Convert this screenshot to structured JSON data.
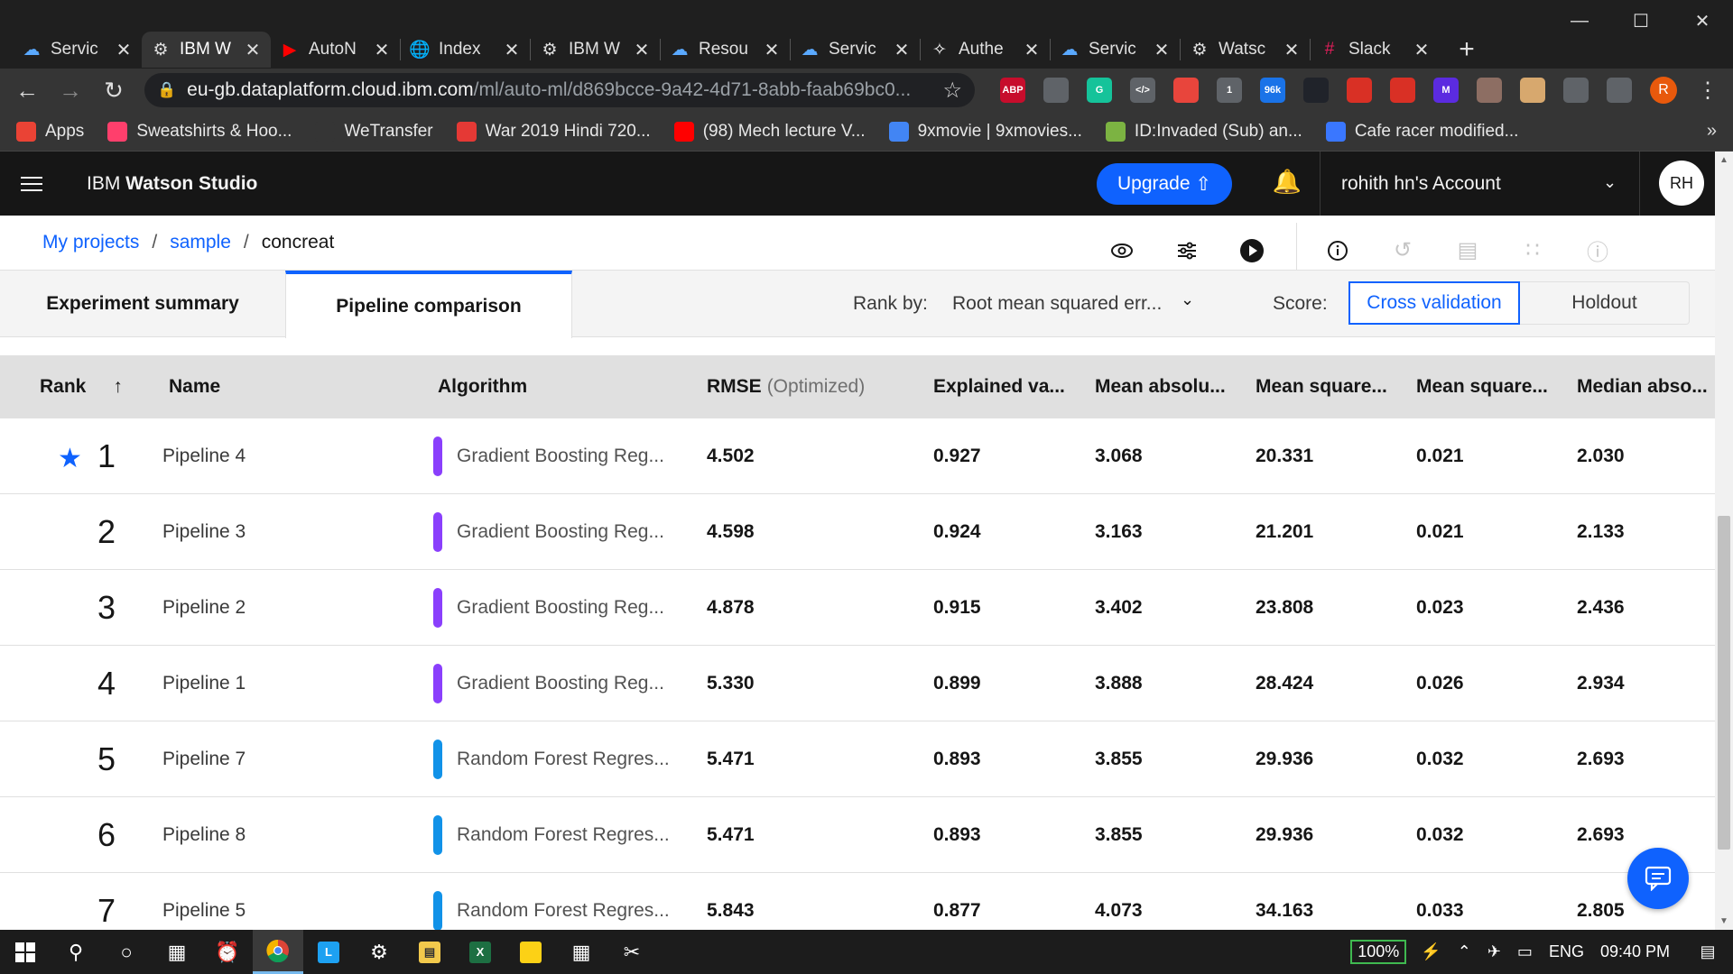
{
  "browser": {
    "tabs": [
      {
        "label": "Servic",
        "icon": "ibm-cloud-icon",
        "active": false
      },
      {
        "label": "IBM W",
        "icon": "watson-icon",
        "active": true
      },
      {
        "label": "AutoN",
        "icon": "youtube-icon",
        "active": false
      },
      {
        "label": "Index",
        "icon": "globe-icon",
        "active": false
      },
      {
        "label": "IBM W",
        "icon": "watson-icon",
        "active": false
      },
      {
        "label": "Resou",
        "icon": "ibm-cloud-icon",
        "active": false
      },
      {
        "label": "Servic",
        "icon": "ibm-cloud-icon",
        "active": false
      },
      {
        "label": "Authe",
        "icon": "auth-icon",
        "active": false
      },
      {
        "label": "Servic",
        "icon": "ibm-cloud-icon",
        "active": false
      },
      {
        "label": "Watsc",
        "icon": "watson-icon",
        "active": false
      },
      {
        "label": "Slack",
        "icon": "slack-icon",
        "active": false
      }
    ],
    "url_host": "eu-gb.dataplatform.cloud.ibm.com",
    "url_path": "/ml/auto-ml/d869bcce-9a42-4d71-8abb-faab69bc0...",
    "extensions": [
      {
        "name": "abp",
        "label": "ABP",
        "color": "#c70d2c"
      },
      {
        "name": "shield",
        "label": "",
        "color": "#5f6368"
      },
      {
        "name": "grammarly",
        "label": "G",
        "color": "#15c39a"
      },
      {
        "name": "code",
        "label": "</>",
        "color": "#5f6368"
      },
      {
        "name": "spiral",
        "label": "",
        "color": "#e8453c"
      },
      {
        "name": "link",
        "label": "1",
        "color": "#5f6368"
      },
      {
        "name": "bird",
        "label": "96k",
        "color": "#1a73e8"
      },
      {
        "name": "react",
        "label": "",
        "color": "#20232a"
      },
      {
        "name": "arrow",
        "label": "",
        "color": "#d93025"
      },
      {
        "name": "record",
        "label": "",
        "color": "#d93025"
      },
      {
        "name": "m",
        "label": "M",
        "color": "#5b2be0"
      },
      {
        "name": "cookie1",
        "label": "",
        "color": "#8d6e63"
      },
      {
        "name": "cookie2",
        "label": "",
        "color": "#d7a86e"
      },
      {
        "name": "puzzle",
        "label": "",
        "color": "#5f6368"
      },
      {
        "name": "playlist",
        "label": "",
        "color": "#5f6368"
      }
    ],
    "profile_initial": "R",
    "bookmarks": [
      {
        "label": "Apps",
        "icon": "apps-grid-icon",
        "color": "#ea4335"
      },
      {
        "label": "Sweatshirts & Hoo...",
        "icon": "myntra-icon",
        "color": "#ff3f6c"
      },
      {
        "label": "WeTransfer",
        "icon": "wetransfer-icon",
        "color": "#353535"
      },
      {
        "label": "War 2019 Hindi 720...",
        "icon": "play-icon",
        "color": "#e53935"
      },
      {
        "label": "(98) Mech lecture V...",
        "icon": "youtube-icon",
        "color": "#ff0000"
      },
      {
        "label": "9xmovie | 9xmovies...",
        "icon": "film-icon",
        "color": "#4285f4"
      },
      {
        "label": "ID:Invaded (Sub) an...",
        "icon": "colorful-icon",
        "color": "#7cb342"
      },
      {
        "label": "Cafe racer modified...",
        "icon": "olx-icon",
        "color": "#3a77ff"
      }
    ]
  },
  "header": {
    "product_prefix": "IBM ",
    "product_name": "Watson Studio",
    "upgrade_label": "Upgrade",
    "account_label": "rohith hn's Account",
    "avatar_initials": "RH"
  },
  "breadcrumb": {
    "items": [
      "My projects",
      "sample"
    ],
    "current": "concreat",
    "separator": "/"
  },
  "tabs": {
    "experiment_summary": "Experiment summary",
    "pipeline_comparison": "Pipeline comparison"
  },
  "controls": {
    "rank_by_label": "Rank by:",
    "rank_by_value": "Root mean squared err...",
    "score_label": "Score:",
    "cross_validation": "Cross validation",
    "holdout": "Holdout"
  },
  "table": {
    "headers": {
      "rank": "Rank",
      "name": "Name",
      "algorithm": "Algorithm",
      "rmse": "RMSE",
      "rmse_note": "(Optimized)",
      "explained_variance": "Explained va...",
      "mean_absolute": "Mean absolu...",
      "mean_squared": "Mean square...",
      "mean_squared_log": "Mean square...",
      "median_absolute": "Median abso..."
    },
    "rows": [
      {
        "rank": "1",
        "name": "Pipeline 4",
        "algorithm": "Gradient Boosting Reg...",
        "algo_color": "#8a3ffc",
        "rmse": "4.502",
        "ev": "0.927",
        "mae": "3.068",
        "mse": "20.331",
        "msle": "0.021",
        "medae": "2.030",
        "starred": true
      },
      {
        "rank": "2",
        "name": "Pipeline 3",
        "algorithm": "Gradient Boosting Reg...",
        "algo_color": "#8a3ffc",
        "rmse": "4.598",
        "ev": "0.924",
        "mae": "3.163",
        "mse": "21.201",
        "msle": "0.021",
        "medae": "2.133",
        "starred": false
      },
      {
        "rank": "3",
        "name": "Pipeline 2",
        "algorithm": "Gradient Boosting Reg...",
        "algo_color": "#8a3ffc",
        "rmse": "4.878",
        "ev": "0.915",
        "mae": "3.402",
        "mse": "23.808",
        "msle": "0.023",
        "medae": "2.436",
        "starred": false
      },
      {
        "rank": "4",
        "name": "Pipeline 1",
        "algorithm": "Gradient Boosting Reg...",
        "algo_color": "#8a3ffc",
        "rmse": "5.330",
        "ev": "0.899",
        "mae": "3.888",
        "mse": "28.424",
        "msle": "0.026",
        "medae": "2.934",
        "starred": false
      },
      {
        "rank": "5",
        "name": "Pipeline 7",
        "algorithm": "Random Forest Regres...",
        "algo_color": "#1192e8",
        "rmse": "5.471",
        "ev": "0.893",
        "mae": "3.855",
        "mse": "29.936",
        "msle": "0.032",
        "medae": "2.693",
        "starred": false
      },
      {
        "rank": "6",
        "name": "Pipeline 8",
        "algorithm": "Random Forest Regres...",
        "algo_color": "#1192e8",
        "rmse": "5.471",
        "ev": "0.893",
        "mae": "3.855",
        "mse": "29.936",
        "msle": "0.032",
        "medae": "2.693",
        "starred": false
      },
      {
        "rank": "7",
        "name": "Pipeline 5",
        "algorithm": "Random Forest Regres...",
        "algo_color": "#1192e8",
        "rmse": "5.843",
        "ev": "0.877",
        "mae": "4.073",
        "mse": "34.163",
        "msle": "0.033",
        "medae": "2.805",
        "starred": false
      }
    ]
  },
  "taskbar": {
    "battery": "100%",
    "language": "ENG",
    "time": "09:40 PM"
  }
}
